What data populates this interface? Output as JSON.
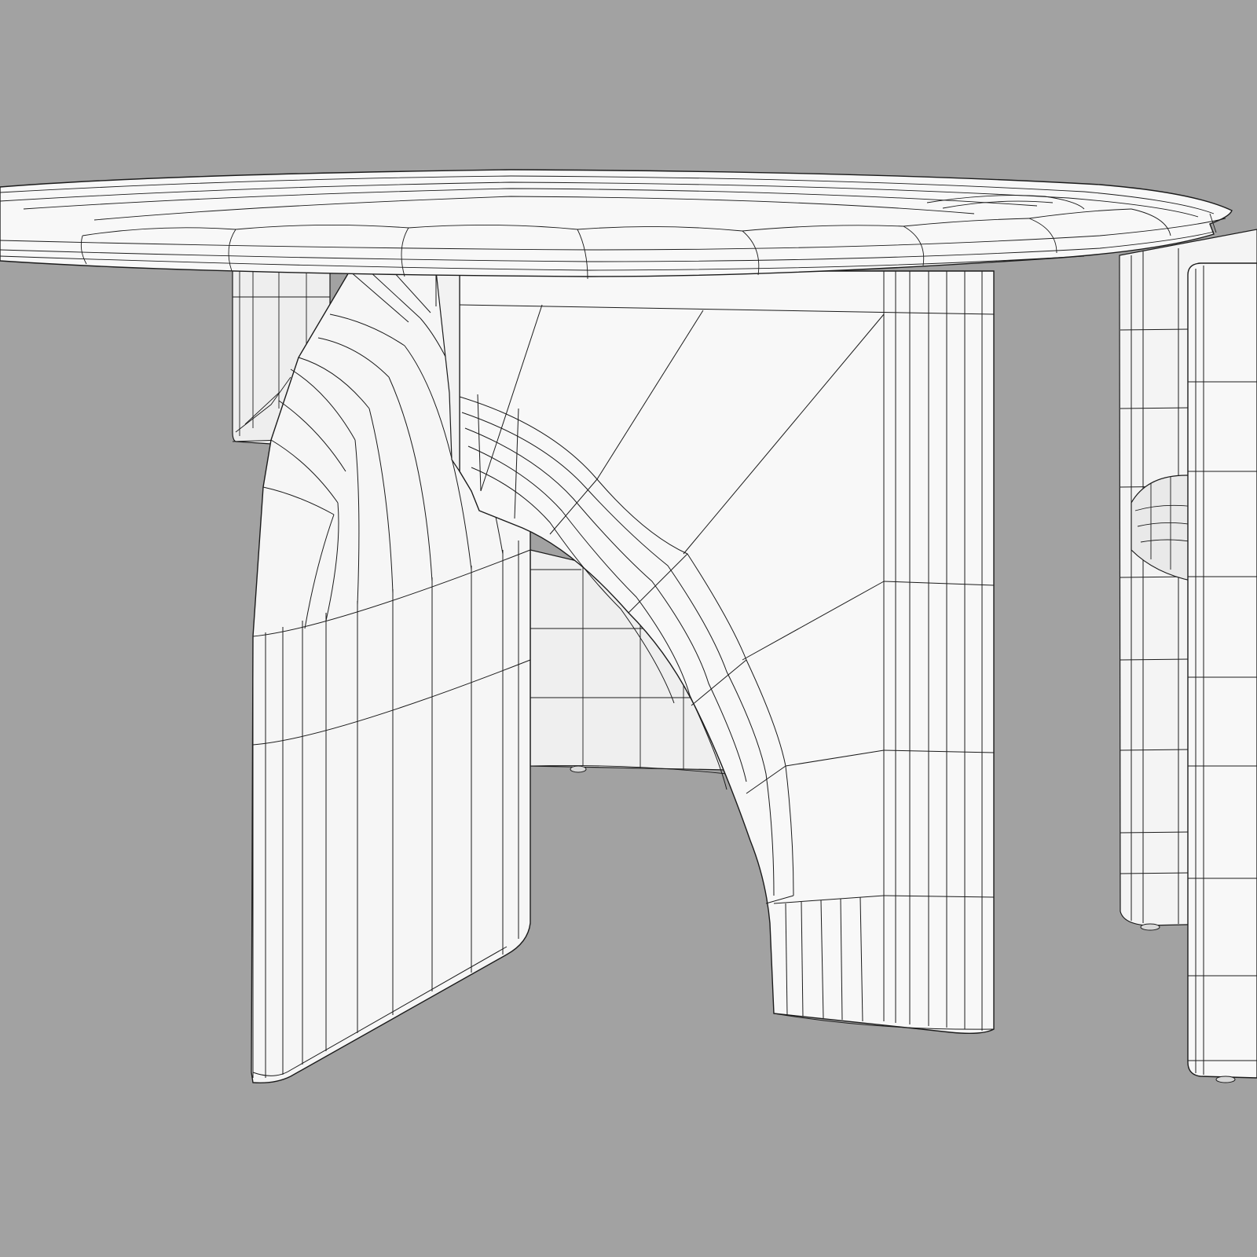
{
  "scene": {
    "background_color": "#a2a2a2",
    "surface_color": "#f7f7f7",
    "shade_color": "#ebebeb",
    "wire_color": "#1c1c1c",
    "objects": [
      "table-top",
      "table-base",
      "chair-back",
      "chair-seat"
    ]
  }
}
